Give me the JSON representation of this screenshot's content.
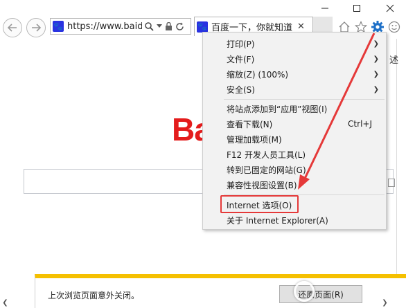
{
  "window": {
    "controls": [
      "minimize-icon",
      "maximize-icon",
      "close-icon"
    ]
  },
  "toolbar": {
    "url": "https://www.baid...",
    "tab_title": "百度一下，你就知道",
    "icons": [
      "back-icon",
      "forward-icon",
      "search-icon",
      "dropdown-icon",
      "lock-icon",
      "refresh-icon",
      "home-icon",
      "favorites-icon",
      "gear-icon",
      "smiley-icon"
    ]
  },
  "page": {
    "logo_text": "Ba",
    "right_cut_text": "述"
  },
  "menu": {
    "items": [
      {
        "label": "打印(P)",
        "shortcut": "",
        "submenu": true
      },
      {
        "label": "文件(F)",
        "shortcut": "",
        "submenu": true
      },
      {
        "label": "缩放(Z) (100%)",
        "shortcut": "",
        "submenu": true
      },
      {
        "label": "安全(S)",
        "shortcut": "",
        "submenu": true
      },
      {
        "label": "将站点添加到“应用”视图(I)",
        "shortcut": "",
        "submenu": false
      },
      {
        "label": "查看下载(N)",
        "shortcut": "Ctrl+J",
        "submenu": false
      },
      {
        "label": "管理加载项(M)",
        "shortcut": "",
        "submenu": false
      },
      {
        "label": "F12 开发人员工具(L)",
        "shortcut": "",
        "submenu": false
      },
      {
        "label": "转到已固定的网站(G)",
        "shortcut": "",
        "submenu": false
      },
      {
        "label": "兼容性视图设置(B)",
        "shortcut": "",
        "submenu": false
      },
      {
        "label": "Internet 选项(O)",
        "shortcut": "",
        "submenu": false
      },
      {
        "label": "关于 Internet Explorer(A)",
        "shortcut": "",
        "submenu": false
      }
    ],
    "highlighted_item": "Internet 选项(O)"
  },
  "notification": {
    "text": "上次浏览页面意外关闭。",
    "button": "还原页面(R)"
  },
  "colors": {
    "annotation_red": "#e53939",
    "notification_yellow": "#f5c000",
    "logo_red": "#e41c1c",
    "ie_blue": "#1e70c8"
  }
}
